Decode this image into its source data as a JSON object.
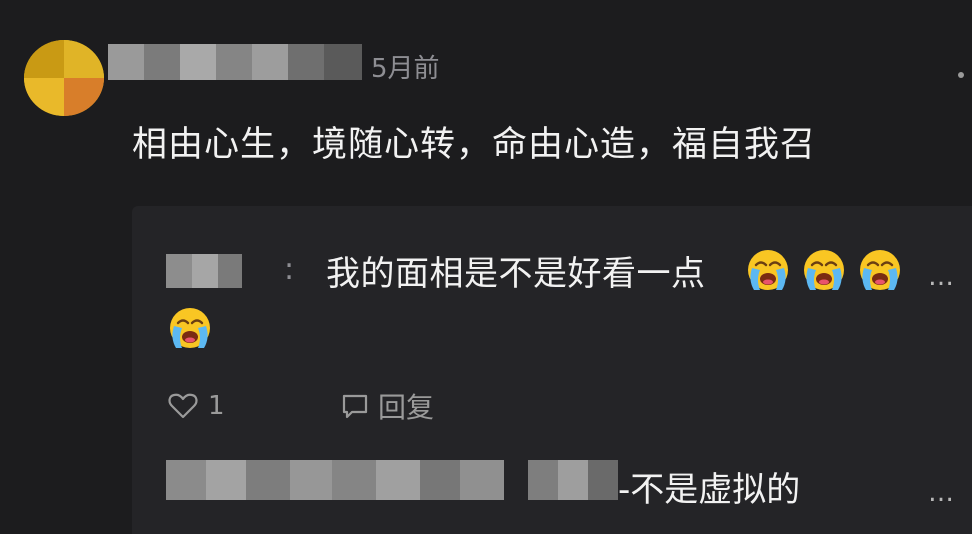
{
  "comment": {
    "time": "5月前",
    "text": "相由心生，境随心转，命由心造，福自我召"
  },
  "reply": {
    "separator": ":",
    "text": "我的面相是不是好看一点",
    "emoji_icon": "loudly-crying-face-icon",
    "more_label": "…",
    "like_count": "1",
    "reply_label": "回复"
  },
  "sub_reply": {
    "text": "-不是虚拟的",
    "more_label": "…"
  },
  "colors": {
    "background": "#1c1c1e",
    "panel": "#242427",
    "text": "#f2f2f2",
    "muted": "#8e8e93",
    "emoji_face": "#f9c623"
  }
}
